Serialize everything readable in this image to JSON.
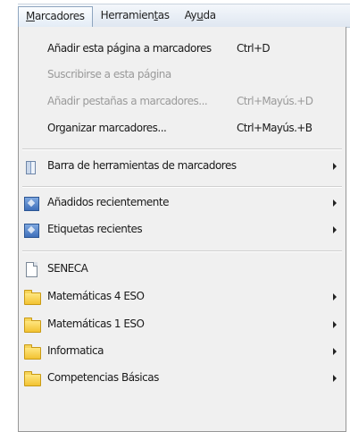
{
  "menubar": {
    "menus": [
      {
        "pre": "",
        "u": "M",
        "post": "arcadores"
      },
      {
        "pre": "Herramien",
        "u": "t",
        "post": "as"
      },
      {
        "pre": "Ay",
        "u": "u",
        "post": "da"
      }
    ]
  },
  "dropdown": {
    "items": [
      {
        "label": "Añadir esta página a marcadores",
        "shortcut": "Ctrl+D"
      },
      {
        "label": "Suscribirse a esta página",
        "shortcut": ""
      },
      {
        "label": "Añadir pestañas a marcadores...",
        "shortcut": "Ctrl+Mayús.+D"
      },
      {
        "label": "Organizar marcadores...",
        "shortcut": "Ctrl+Mayús.+B"
      },
      {
        "label": "Barra de herramientas de marcadores",
        "icon": "bookmarks-toolbar-icon"
      },
      {
        "label": "Añadidos recientemente",
        "icon": "smart-folder-icon"
      },
      {
        "label": "Etiquetas recientes",
        "icon": "smart-folder-icon"
      },
      {
        "label": "SENECA",
        "icon": "page-icon"
      },
      {
        "label": "Matemáticas 4 ESO",
        "icon": "folder-icon"
      },
      {
        "label": "Matemáticas 1 ESO",
        "icon": "folder-icon"
      },
      {
        "label": "Informatica",
        "icon": "folder-icon"
      },
      {
        "label": "Competencias Básicas",
        "icon": "folder-icon"
      }
    ]
  }
}
